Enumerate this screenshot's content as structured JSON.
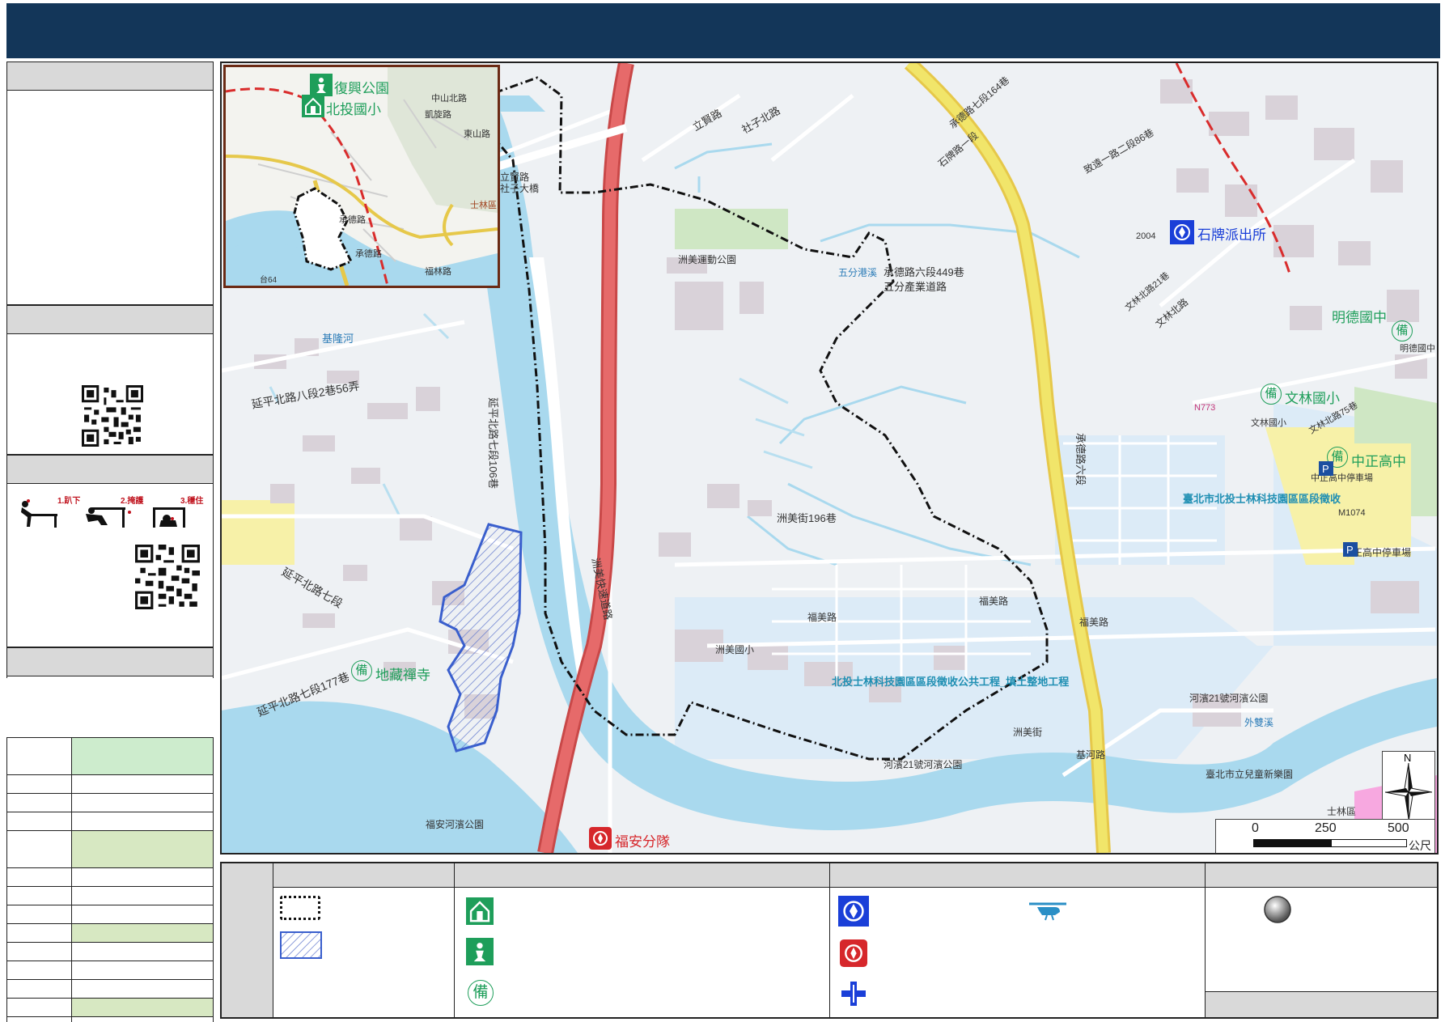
{
  "map": {
    "inset_labels": {
      "fuxing_park": "復興公園",
      "beitou_elem": "北投國小",
      "zhongshan_n_rd": "中山北路",
      "kaixuan_rd": "凱旋路",
      "dongshan_rd": "東山路",
      "shilin": "士林區",
      "chengde_rd_1": "承德路",
      "chengde_rd_2": "承德路",
      "fulin_rd": "福林路",
      "tai64": "台64"
    },
    "road_labels": {
      "lidao_rd": "立賢路",
      "shezi_bridge": "社子大橋",
      "lidao_rd2": "立賢路",
      "shezi_rd": "社子北路",
      "yanping_8_56": "延平北路八段2巷56弄",
      "yanping_7_106": "延平北路七段106巷",
      "yanping_7": "延平北路七段",
      "yanping_7_177": "延平北路七段177巷",
      "keelung_river": "基隆河",
      "zhoumei_express": "洲美快速道路",
      "zhoumei_st_196": "洲美街196巷",
      "wufen_port": "五分港溪",
      "chengde_6_449": "承德路六段449巷",
      "wufen_ind_rd": "五分產業道路",
      "chengde_6": "承德路六段",
      "fumei_rd": "福美路",
      "fumei_rd2": "福美路",
      "zhoumei_st": "洲美街",
      "jilu_rd": "基河路",
      "chengde_7_164": "承德路七段164巷",
      "shipai_rd": "石牌路一段",
      "zhiqiang_st": "致遠一路二段86巷",
      "wenlin_n_rd": "文林北路",
      "wenlin_n_21": "文林北路21巷",
      "wenlin_n_75": "文林北路75巷",
      "n773": "N773",
      "m1074": "M1074",
      "river_park": "河濱21號河濱公園",
      "fuan_river_park": "福安河濱公園",
      "zhoumei_sports_park": "洲美運動公園",
      "zhoumei_elem": "洲美國小",
      "fumei_rd3": "福美路",
      "project": "北投士林科技園區區段徵收公共工程_填土整地工程",
      "land_collection": "臺北市北投士林科技園區區段徵收",
      "zhongzheng_hs_parking": "中正高中停車場",
      "zhongzheng_hs_small": "中正高中停車場",
      "wenlin_elem_small": "文林國小",
      "mingde_small": "明德國中",
      "waishuang_river": "外雙溪",
      "children_park": "臺北市立兒童新樂園",
      "river_park_2": "河濱21號河濱公園",
      "shilin_district": "士林區",
      "n2004": "2004"
    },
    "facility_labels": {
      "shipai_police": "石牌派出所",
      "mingde_jh": "明德國中",
      "wenlin_elem": "文林國小",
      "zhongzheng_hs": "中正高中",
      "dizang_temple": "地藏禪寺",
      "fuan_brigade": "福安分隊"
    },
    "scale": {
      "t0": "0",
      "t250": "250",
      "t500": "500",
      "unit": "公尺"
    },
    "north": "N"
  },
  "sidebar": {
    "drill_steps": [
      "1.趴下",
      "2.掩護",
      "3.穩住"
    ]
  },
  "colors": {
    "title_bar": "#133659",
    "river": "#a9d9ee",
    "expressway": "#e05a5a",
    "highway": "#f1e56a",
    "green": "#cfe7c4",
    "panel_head": "#d9d9d9",
    "hatch": "#3a5fcd"
  }
}
